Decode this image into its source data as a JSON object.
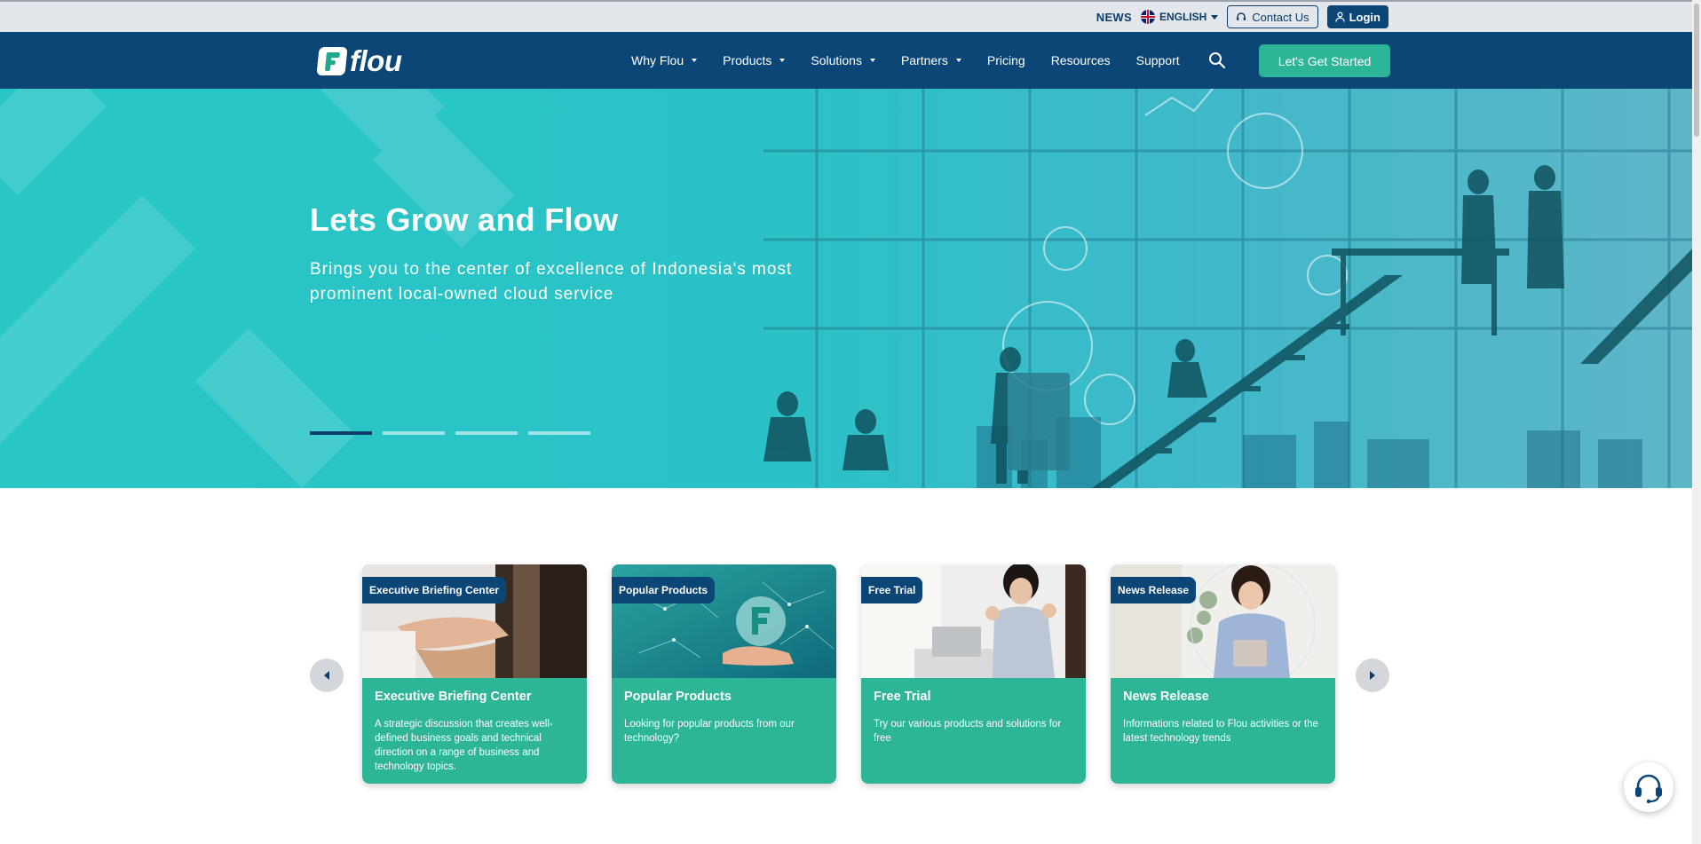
{
  "topbar": {
    "news": "NEWS",
    "language": "ENGLISH",
    "contact": "Contact Us",
    "login": "Login"
  },
  "nav": {
    "logo_text": "flou",
    "menu": [
      {
        "label": "Why Flou",
        "dropdown": true
      },
      {
        "label": "Products",
        "dropdown": true
      },
      {
        "label": "Solutions",
        "dropdown": true
      },
      {
        "label": "Partners",
        "dropdown": true
      },
      {
        "label": "Pricing",
        "dropdown": false
      },
      {
        "label": "Resources",
        "dropdown": false
      },
      {
        "label": "Support",
        "dropdown": false
      }
    ],
    "cta": "Let's Get Started"
  },
  "hero": {
    "title": "Lets Grow and Flow",
    "subtitle": "Brings you to the center of excellence of Indonesia's most prominent local-owned cloud service",
    "slides_total": 4,
    "active_slide": 1
  },
  "cards": [
    {
      "badge": "Executive Briefing Center",
      "title": "Executive Briefing Center",
      "description": "A strategic discussion that creates well-defined business goals and technical direction on a range of business and technology topics."
    },
    {
      "badge": "Popular Products",
      "title": "Popular Products",
      "description": "Looking for popular products from our technology?"
    },
    {
      "badge": "Free Trial",
      "title": "Free Trial",
      "description": "Try our various products and solutions for free"
    },
    {
      "badge": "News Release",
      "title": "News Release",
      "description": "Informations related to Flou activities or the latest technology trends"
    }
  ],
  "colors": {
    "navy": "#0b4677",
    "teal": "#2cb597",
    "hero": "#2ac2c7"
  },
  "icons": {
    "search": "search-icon",
    "help": "headset-icon",
    "prev": "chevron-left-icon",
    "next": "chevron-right-icon"
  }
}
